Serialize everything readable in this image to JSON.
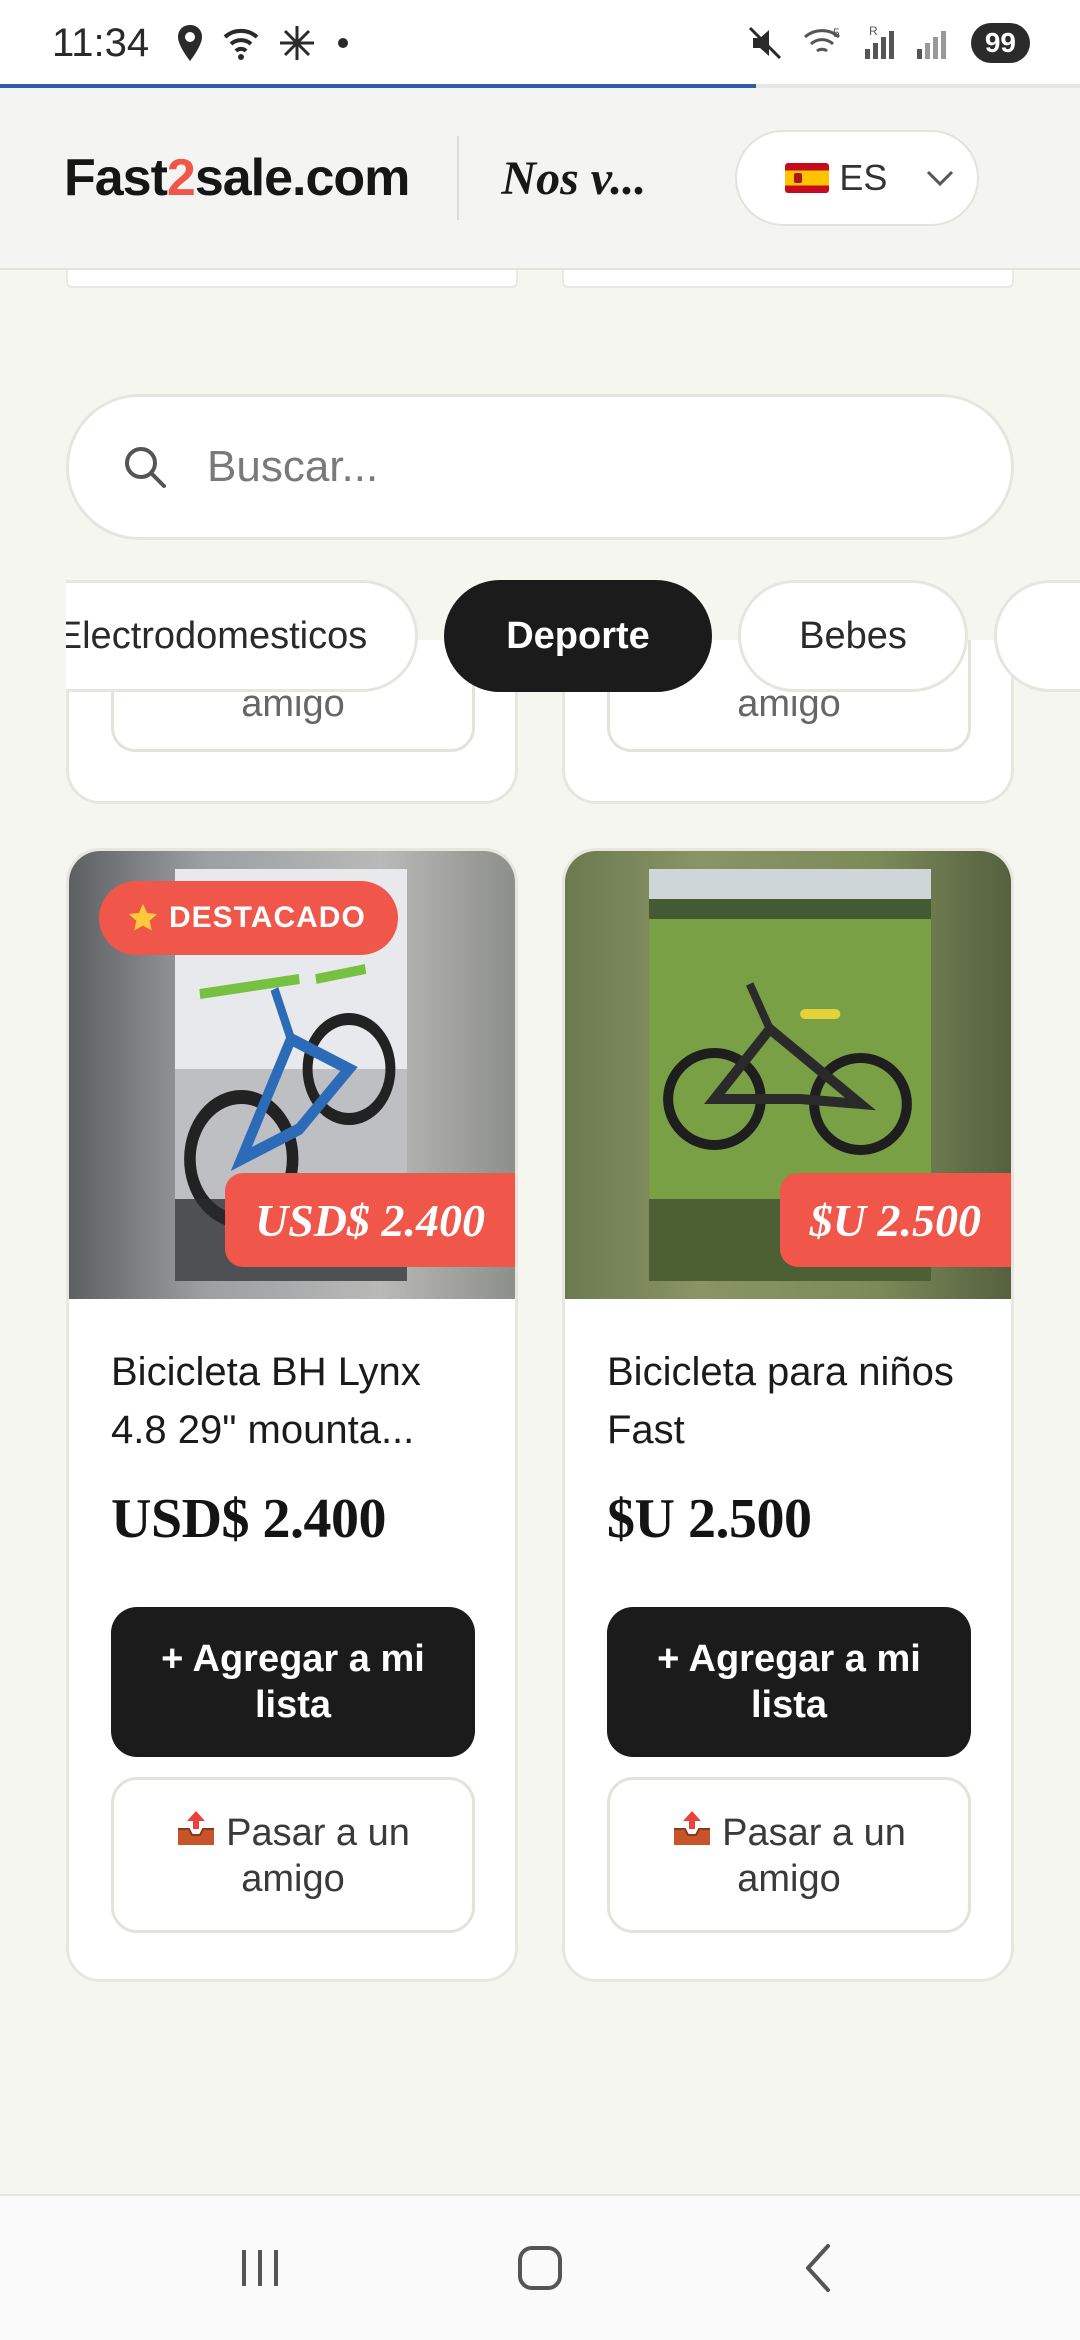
{
  "status_bar": {
    "time": "11:34",
    "battery": "99"
  },
  "browser": {
    "load_progress_percent": 70
  },
  "header": {
    "logo_part1": "Fast",
    "logo_part2": "2",
    "logo_part3": "sale.com",
    "tagline": "Nos v...",
    "language": {
      "flag_icon": "spain-flag-icon",
      "code": "ES"
    }
  },
  "search": {
    "placeholder": "Buscar..."
  },
  "categories": [
    {
      "label": "Electrodomesticos",
      "active": false
    },
    {
      "label": "Deporte",
      "active": true
    },
    {
      "label": "Bebes",
      "active": false
    },
    {
      "label": "",
      "active": false
    }
  ],
  "partial_cards": [
    {
      "share_label": "amigo"
    },
    {
      "share_label": "amigo"
    }
  ],
  "products": [
    {
      "badge": "DESTACADO",
      "badge_icon": "star-icon",
      "price_tag": "USD$ 2.400",
      "title": "Bicicleta BH Lynx 4.8 29\" mounta...",
      "price": "USD$ 2.400",
      "add_label": "+ Agregar a mi lista",
      "share_label": "Pasar a un amigo",
      "share_icon": "outbox-tray-icon"
    },
    {
      "badge": "",
      "price_tag": "$U 2.500",
      "title": "Bicicleta para niños Fast",
      "price": "$U 2.500",
      "add_label": "+ Agregar a mi lista",
      "share_label": "Pasar a un amigo",
      "share_icon": "outbox-tray-icon"
    }
  ],
  "colors": {
    "accent": "#f0574a",
    "dark": "#1b1b1b",
    "background": "#f6f6f1"
  }
}
